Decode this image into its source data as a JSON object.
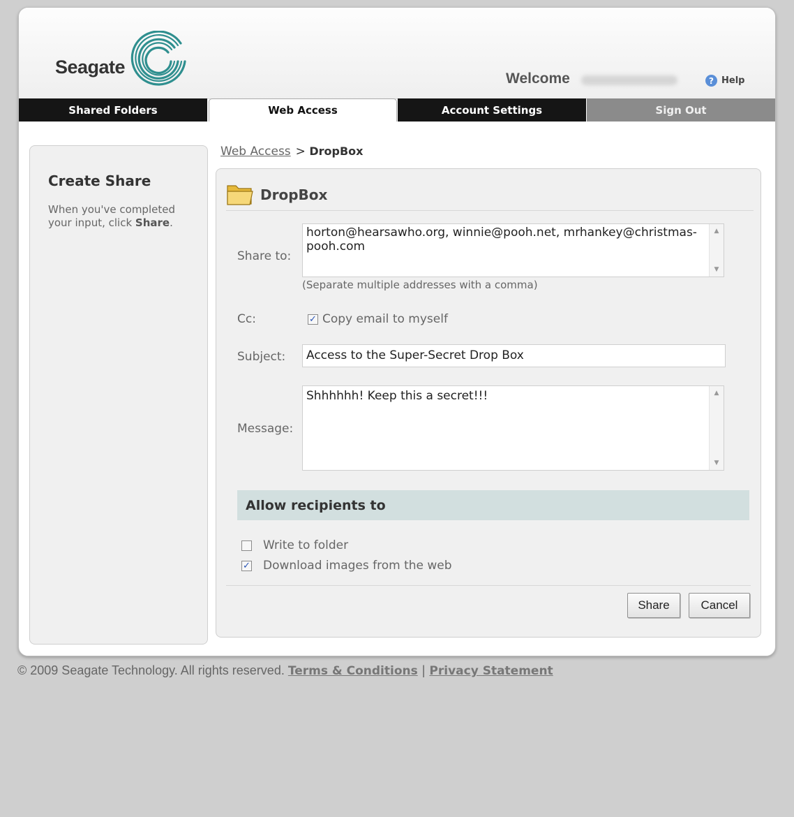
{
  "header": {
    "logo_text": "Seagate",
    "welcome": "Welcome",
    "help": "Help"
  },
  "tabs": [
    {
      "label": "Shared Folders",
      "active": false
    },
    {
      "label": "Web Access",
      "active": true
    },
    {
      "label": "Account Settings",
      "active": false
    },
    {
      "label": "Sign Out",
      "active": false
    }
  ],
  "sidebar": {
    "title": "Create Share",
    "hint_prefix": "When you've completed your input, click",
    "hint_bold": "Share",
    "hint_suffix": "."
  },
  "breadcrumb": {
    "parent": "Web Access",
    "separator": ">",
    "current": "DropBox"
  },
  "panel": {
    "title": "DropBox",
    "folder_icon": "folder-icon"
  },
  "form": {
    "share_to": {
      "label": "Share to:",
      "value": "horton@hearsawho.org, winnie@pooh.net, mrhankey@christmas-pooh.com",
      "helper": "(Separate multiple addresses with a comma)"
    },
    "cc": {
      "label": "Cc:",
      "checkbox_label": "Copy email to myself",
      "checked": true
    },
    "subject": {
      "label": "Subject:",
      "value": "Access to the Super-Secret Drop Box"
    },
    "message": {
      "label": "Message:",
      "value": "Shhhhhh! Keep this a secret!!!"
    }
  },
  "permissions": {
    "heading": "Allow recipients to",
    "options": [
      {
        "label": "Write to folder",
        "checked": false
      },
      {
        "label": "Download images from the web",
        "checked": true
      }
    ]
  },
  "buttons": {
    "share": "Share",
    "cancel": "Cancel"
  },
  "footer": {
    "copyright": "© 2009 Seagate Technology. All rights reserved.",
    "terms": "Terms & Conditions",
    "separator": "|",
    "privacy": "Privacy Statement"
  },
  "colors": {
    "page_bg": "#cfcfcf",
    "tab_bg": "#151515",
    "signout_bg": "#8b8b8b",
    "logo_teal": "#2f8f8f",
    "section_bar": "#d2dfdf",
    "help_blue": "#5a8fd8"
  }
}
